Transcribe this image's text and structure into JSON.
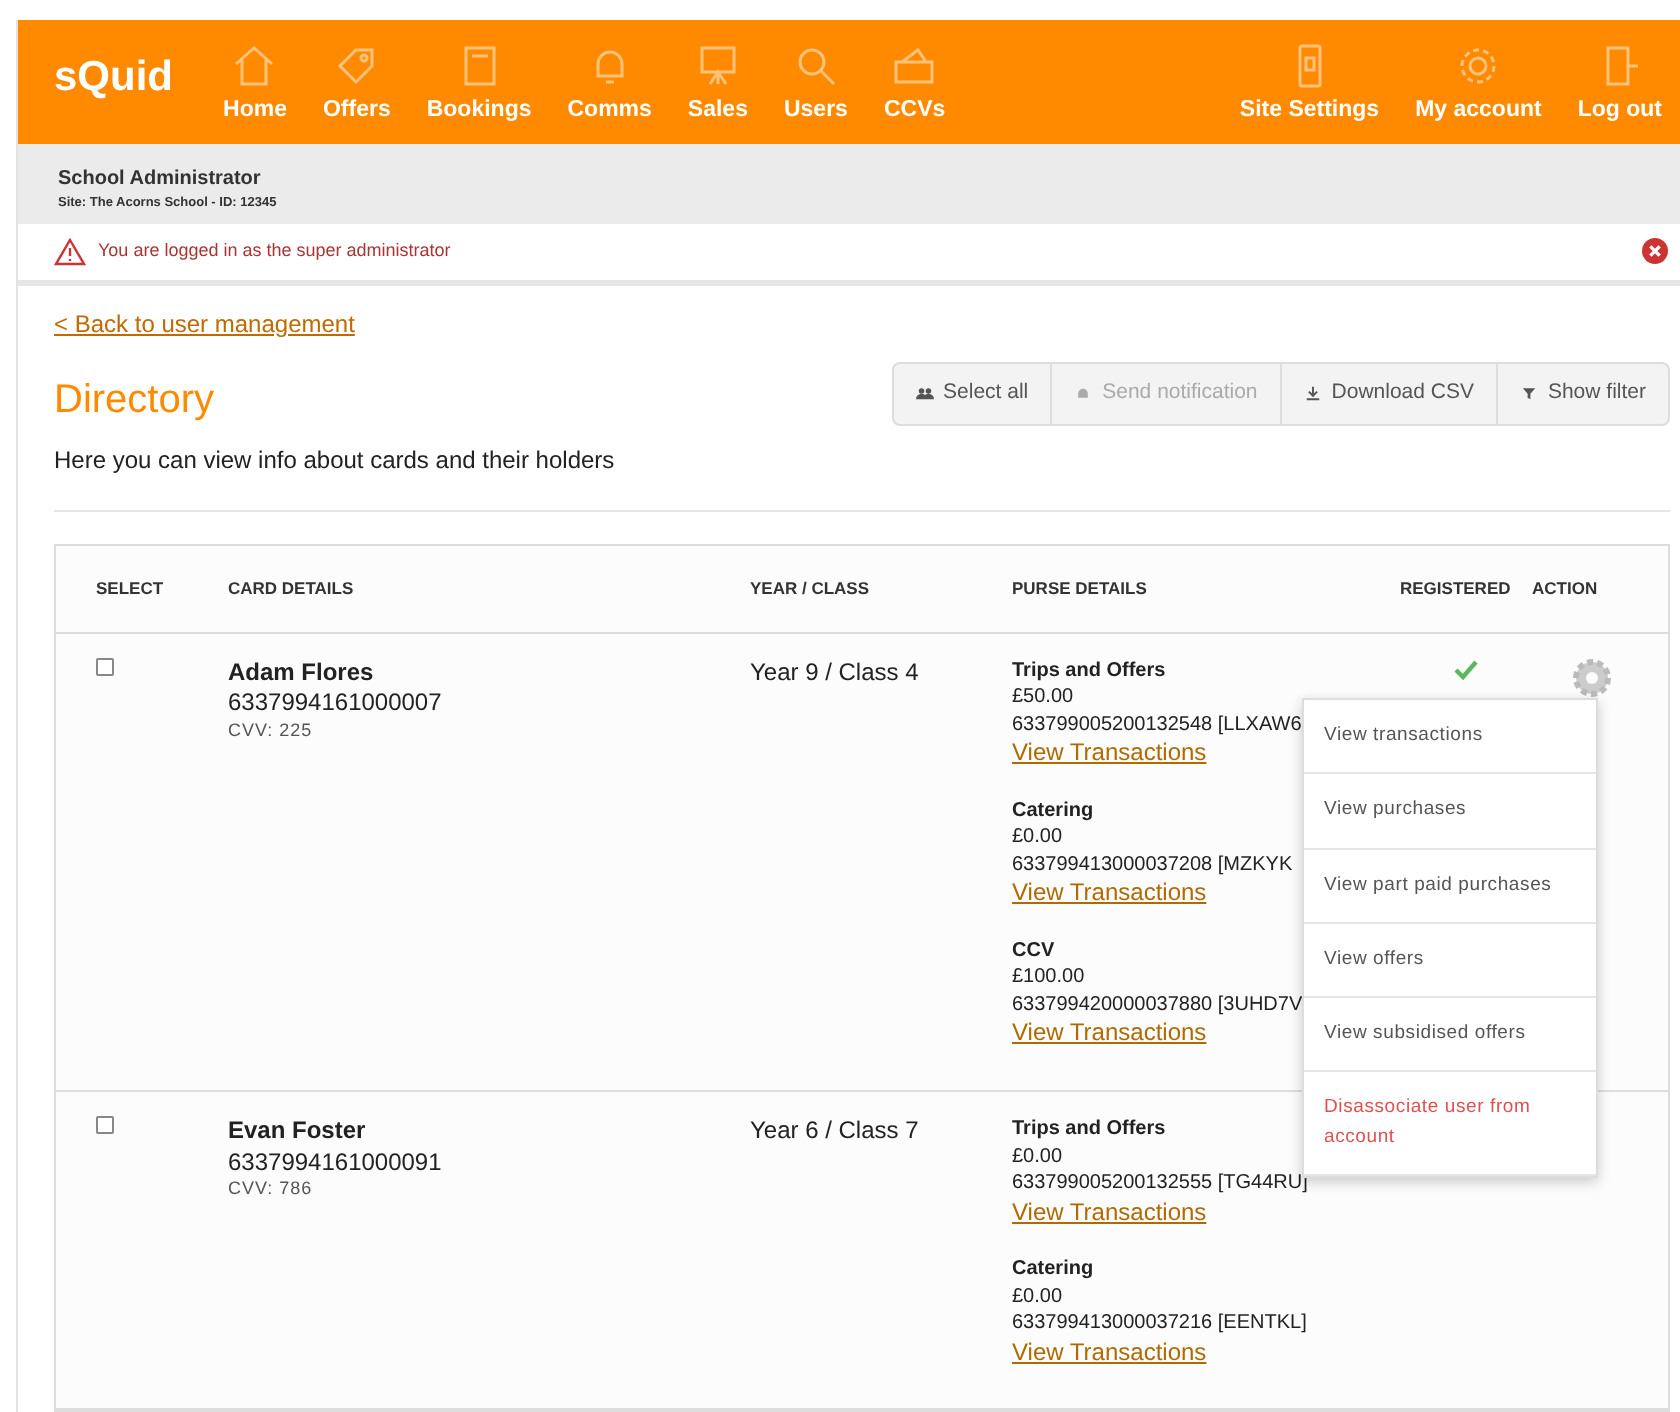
{
  "brand": "sQuid",
  "nav_left": [
    {
      "label": "Home"
    },
    {
      "label": "Offers"
    },
    {
      "label": "Bookings"
    },
    {
      "label": "Comms"
    },
    {
      "label": "Sales"
    },
    {
      "label": "Users"
    },
    {
      "label": "CCVs"
    }
  ],
  "nav_right": [
    {
      "label": "Site Settings"
    },
    {
      "label": "My account"
    },
    {
      "label": "Log out"
    }
  ],
  "user_bar": {
    "title": "School Administrator",
    "site": "Site: The Acorns School - ID: 12345"
  },
  "alert": {
    "message": "You are logged in as the super administrator"
  },
  "back_link": "< Back to user management",
  "heading": "Directory",
  "description": "Here you can view info about cards and their holders",
  "toolbar": [
    {
      "label": "Select all",
      "disabled": false
    },
    {
      "label": "Send notification",
      "disabled": true
    },
    {
      "label": "Download CSV",
      "disabled": false
    },
    {
      "label": "Show filter",
      "disabled": false
    }
  ],
  "table": {
    "columns": [
      "SELECT",
      "CARD DETAILS",
      "YEAR / CLASS",
      "PURSE DETAILS",
      "REGISTERED",
      "ACTION"
    ],
    "rows": [
      {
        "checked": false,
        "name": "Adam Flores",
        "card_number": "6337994161000007",
        "cvv": "CVV: 225",
        "year_class": "Year 9 / Class 4",
        "registered": true,
        "purses": [
          {
            "name": "Trips and Offers",
            "balance": "£50.00",
            "account": "633799005200132548 [LLXAW6",
            "link": "View Transactions"
          },
          {
            "name": "Catering",
            "balance": "£0.00",
            "account": "633799413000037208 [MZKYK",
            "link": "View Transactions"
          },
          {
            "name": "CCV",
            "balance": "£100.00",
            "account": "633799420000037880 [3UHD7V",
            "link": "View Transactions"
          }
        ]
      },
      {
        "checked": false,
        "name": "Evan Foster",
        "card_number": "6337994161000091",
        "cvv": "CVV: 786",
        "year_class": "Year 6 / Class 7",
        "purses": [
          {
            "name": "Trips and Offers",
            "balance": "£0.00",
            "account": "633799005200132555 [TG44RU]",
            "link": "View Transactions"
          },
          {
            "name": "Catering",
            "balance": "£0.00",
            "account": "633799413000037216 [EENTKL]",
            "link": "View Transactions"
          }
        ]
      }
    ]
  },
  "action_menu": [
    {
      "label": "View transactions",
      "kind": "normal"
    },
    {
      "label": "View purchases",
      "kind": "normal"
    },
    {
      "label": "View part paid purchases",
      "kind": "normal"
    },
    {
      "label": "View offers",
      "kind": "normal"
    },
    {
      "label": "View subsidised offers",
      "kind": "normal"
    },
    {
      "label": "Disassociate user from account",
      "kind": "danger"
    }
  ]
}
